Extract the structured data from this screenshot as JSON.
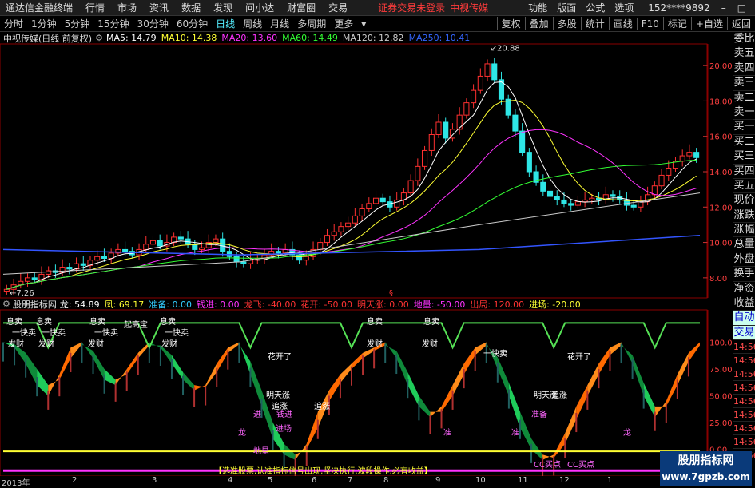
{
  "titlebar": {
    "app": "通达信金融终端",
    "menus": [
      "行情",
      "市场",
      "资讯",
      "数据",
      "发现",
      "问小达",
      "财富圈",
      "交易"
    ],
    "alert": "证券交易未登录",
    "stock": "中视传媒",
    "right_menus": [
      "功能",
      "版面",
      "公式",
      "选项"
    ],
    "account": "152****9892",
    "window_buttons": [
      "–",
      "□",
      "×"
    ]
  },
  "periods": [
    "分时",
    "1分钟",
    "5分钟",
    "15分钟",
    "30分钟",
    "60分钟",
    "日线",
    "周线",
    "月线",
    "多周期",
    "更多"
  ],
  "period_selected": "日线",
  "tools": [
    "复权",
    "叠加",
    "多股",
    "统计",
    "画线",
    "F10",
    "标记",
    "+自选",
    "返回"
  ],
  "main_chart": {
    "name": "中视传媒(日线 前复权)",
    "ma": [
      {
        "label": "MA5: 14.79",
        "color": "#ffffff"
      },
      {
        "label": "MA10: 14.38",
        "color": "#ffff33"
      },
      {
        "label": "MA20: 13.60",
        "color": "#ff33ff"
      },
      {
        "label": "MA60: 14.49",
        "color": "#33ff33"
      },
      {
        "label": "MA120: 12.82",
        "color": "#cccccc"
      },
      {
        "label": "MA250: 10.41",
        "color": "#3366ff"
      }
    ],
    "high_label": "20.88",
    "low_label": "7.26",
    "mark": "§"
  },
  "sub_chart": {
    "name": "股朋指标网",
    "vals": [
      {
        "label": "龙: 54.89",
        "color": "#ffffff"
      },
      {
        "label": "凤: 69.17",
        "color": "#ffff33"
      },
      {
        "label": "准备: 0.00",
        "color": "#33ccff"
      },
      {
        "label": "钱进: 0.00",
        "color": "#ff33ff"
      },
      {
        "label": "龙飞: -40.00",
        "color": "#ff3333"
      },
      {
        "label": "花开: -50.00",
        "color": "#ff3333"
      },
      {
        "label": "明天涨: 0.00",
        "color": "#ff3333"
      },
      {
        "label": "地量: -50.00",
        "color": "#ff33ff"
      },
      {
        "label": "出局: 120.00",
        "color": "#ff3333"
      },
      {
        "label": "进场: -20.00",
        "color": "#ffff33"
      }
    ],
    "slogan": "【选准股票,认准指标信号出现,坚决执行,波段操作,必有收益】",
    "annotations": [
      "息卖",
      "一快卖",
      "发财",
      "息卖",
      "一快卖",
      "发财",
      "息卖",
      "一快卖",
      "发财",
      "起高宝",
      "息卖",
      "一快卖",
      "发财",
      "花开了",
      "明天涨",
      "追涨",
      "追涨",
      "进",
      "龙",
      "钱进",
      "进场",
      "地星",
      "一快卖",
      "花开了",
      "明天涨",
      "追涨",
      "准备",
      "CC买点",
      "CC买点",
      "息卖",
      "发财",
      "息卖",
      "发财",
      "准",
      "龙",
      "准"
    ]
  },
  "right_panel": [
    "委比",
    "卖五",
    "卖四",
    "卖三",
    "卖二",
    "卖一",
    "买一",
    "买二",
    "买三",
    "买四",
    "买五",
    "现价",
    "涨跌",
    "涨幅",
    "总量",
    "外盘",
    "换手",
    "净资",
    "收益",
    "自动",
    "交易",
    "14:56",
    "14:56",
    "14:56",
    "14:56",
    "14:56",
    "14:56",
    "14:56",
    "14:56",
    "14:56"
  ],
  "x_axis": [
    "2013年",
    "2",
    "3",
    "4",
    "5",
    "6",
    "7",
    "8",
    "9",
    "10",
    "11",
    "12",
    "1"
  ],
  "watermark": {
    "line1": "股朋指标网",
    "line2": "www.7gpzb.com"
  },
  "chart_data": [
    {
      "type": "candlestick",
      "title": "中视传媒(日线 前复权)",
      "ylim": [
        7,
        21
      ],
      "y_ticks": [
        8,
        10,
        12,
        14,
        16,
        18,
        20
      ],
      "x_tick_labels": [
        "2013年",
        "2",
        "3",
        "4",
        "5",
        "6",
        "7",
        "8",
        "9",
        "10",
        "11",
        "12",
        "1"
      ],
      "close": [
        7.35,
        7.6,
        7.8,
        8.0,
        7.9,
        8.2,
        8.4,
        8.3,
        8.6,
        8.5,
        8.8,
        8.7,
        9.0,
        9.2,
        9.1,
        9.4,
        9.6,
        9.5,
        9.3,
        9.6,
        9.9,
        10.1,
        9.8,
        10.0,
        10.3,
        10.2,
        9.9,
        9.6,
        9.7,
        10.0,
        10.2,
        9.5,
        9.2,
        8.9,
        8.8,
        9.0,
        9.1,
        9.3,
        9.5,
        9.4,
        9.6,
        9.3,
        9.0,
        9.2,
        9.6,
        10.0,
        10.4,
        10.6,
        10.9,
        11.1,
        11.5,
        11.9,
        12.2,
        12.5,
        12.3,
        12.0,
        12.4,
        12.8,
        13.5,
        14.3,
        15.2,
        16.1,
        16.8,
        15.9,
        16.4,
        17.2,
        17.9,
        18.6,
        19.4,
        20.1,
        19.2,
        18.1,
        17.2,
        16.3,
        15.1,
        14.0,
        13.4,
        12.9,
        12.6,
        12.4,
        12.2,
        12.1,
        12.3,
        12.4,
        12.5,
        12.4,
        12.7,
        12.6,
        12.4,
        12.1,
        12.0,
        12.3,
        12.7,
        13.2,
        13.8,
        14.2,
        14.6,
        14.9,
        15.1,
        14.8
      ],
      "ma_series": [
        "MA5",
        "MA10",
        "MA20",
        "MA60",
        "MA120",
        "MA250"
      ]
    },
    {
      "type": "area",
      "title": "股朋指标网",
      "ylim": [
        -25,
        125
      ],
      "y_ticks": [
        100,
        75,
        50,
        25,
        0
      ],
      "series": [
        {
          "name": "龙",
          "values": [
            100,
            95,
            80,
            60,
            50,
            70,
            95,
            100,
            85,
            65,
            60,
            75,
            90,
            100,
            95,
            80,
            65,
            55,
            60,
            80,
            95,
            100,
            70,
            40,
            10,
            -5,
            -10,
            5,
            35,
            55,
            70,
            80,
            90,
            95,
            100,
            85,
            60,
            40,
            30,
            40,
            60,
            80,
            95,
            100,
            75,
            50,
            20,
            0,
            -10,
            -5,
            15,
            40,
            60,
            80,
            95,
            100,
            80,
            50,
            30,
            45,
            70,
            90,
            100
          ]
        },
        {
          "name": "凤",
          "values": [
            100,
            98,
            90,
            75,
            60,
            65,
            85,
            98,
            92,
            75,
            65,
            70,
            85,
            97,
            97,
            88,
            72,
            60,
            58,
            72,
            90,
            98,
            82,
            55,
            25,
            5,
            -5,
            0,
            20,
            45,
            62,
            75,
            85,
            92,
            97,
            92,
            72,
            50,
            35,
            35,
            50,
            70,
            88,
            97,
            86,
            62,
            35,
            10,
            -5,
            -8,
            5,
            28,
            50,
            70,
            88,
            97,
            88,
            62,
            40,
            40,
            60,
            82,
            97
          ]
        }
      ]
    }
  ]
}
